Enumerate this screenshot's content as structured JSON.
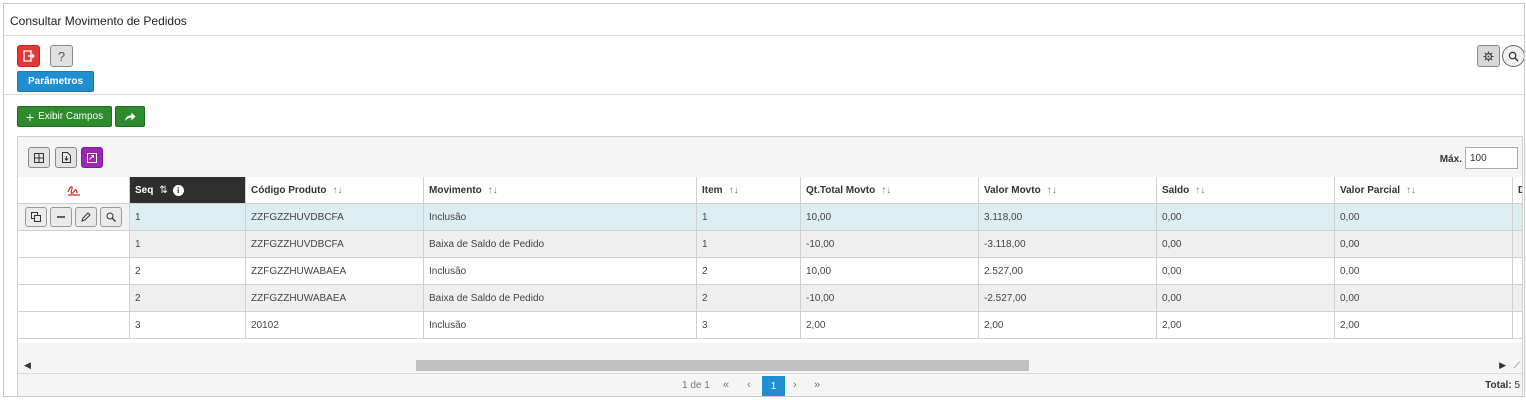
{
  "page": {
    "title": "Consultar Movimento de Pedidos"
  },
  "buttons": {
    "parametros": "Parâmetros",
    "exibir_campos": "Exibir Campos",
    "help": "?"
  },
  "grid": {
    "max_label": "Máx.",
    "max_value": "100",
    "columns": [
      {
        "label": "Seq",
        "sort": "⇅"
      },
      {
        "label": "Código Produto",
        "sort": "↑↓"
      },
      {
        "label": "Movimento",
        "sort": "↑↓"
      },
      {
        "label": "Item",
        "sort": "↑↓"
      },
      {
        "label": "Qt.Total Movto",
        "sort": "↑↓"
      },
      {
        "label": "Valor Movto",
        "sort": "↑↓"
      },
      {
        "label": "Saldo",
        "sort": "↑↓"
      },
      {
        "label": "Valor Parcial",
        "sort": "↑↓"
      },
      {
        "label": "D",
        "sort": ""
      }
    ],
    "rows": [
      {
        "seq": "1",
        "codigo": "ZZFGZZHUVDBCFA",
        "movimento": "Inclusão",
        "item": "1",
        "qt_total": "10,00",
        "valor": "3.118,00",
        "saldo": "0,00",
        "parcial": "0,00"
      },
      {
        "seq": "1",
        "codigo": "ZZFGZZHUVDBCFA",
        "movimento": "Baixa de Saldo de Pedido",
        "item": "1",
        "qt_total": "-10,00",
        "valor": "-3.118,00",
        "saldo": "0,00",
        "parcial": "0,00"
      },
      {
        "seq": "2",
        "codigo": "ZZFGZZHUWABAEA",
        "movimento": "Inclusão",
        "item": "2",
        "qt_total": "10,00",
        "valor": "2.527,00",
        "saldo": "0,00",
        "parcial": "0,00"
      },
      {
        "seq": "2",
        "codigo": "ZZFGZZHUWABAEA",
        "movimento": "Baixa de Saldo de Pedido",
        "item": "2",
        "qt_total": "-10,00",
        "valor": "-2.527,00",
        "saldo": "0,00",
        "parcial": "0,00"
      },
      {
        "seq": "3",
        "codigo": "20102",
        "movimento": "Inclusão",
        "item": "3",
        "qt_total": "2,00",
        "valor": "2,00",
        "saldo": "2,00",
        "parcial": "2,00"
      }
    ]
  },
  "pager": {
    "info": "1 de 1",
    "current": "1",
    "total_label": "Total:",
    "total_value": "5"
  },
  "colors": {
    "accent": "#1f8fcf",
    "green": "#2e8b2e",
    "red": "#e53935",
    "purple": "#9c27b0",
    "selected_row": "#ddeef3"
  }
}
